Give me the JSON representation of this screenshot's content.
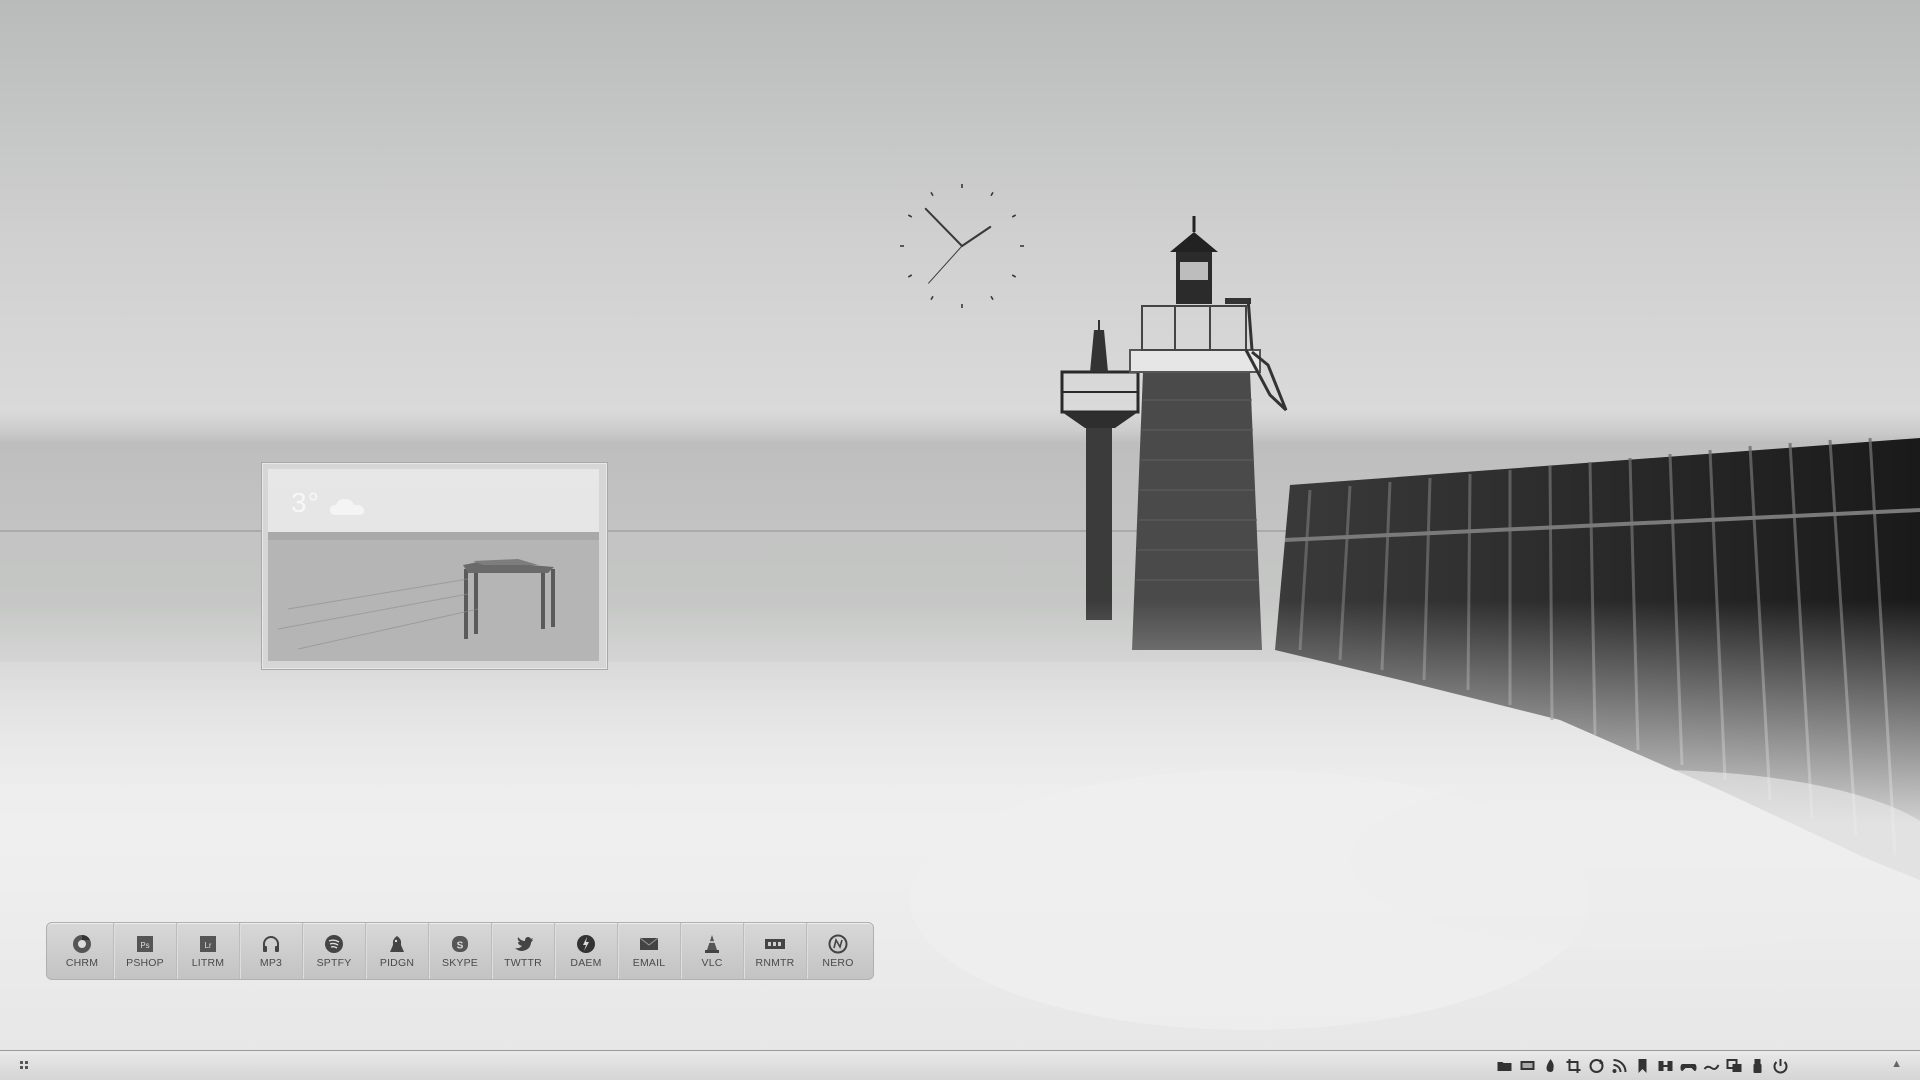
{
  "weather": {
    "temperature": "3°",
    "icon": "cloud-icon"
  },
  "clock": {
    "hour": 1,
    "minute": 52,
    "second": 37
  },
  "dock": {
    "items": [
      {
        "label": "CHRM",
        "icon": "chrome-icon"
      },
      {
        "label": "PSHOP",
        "icon": "photoshop-icon"
      },
      {
        "label": "LITRM",
        "icon": "lightroom-icon"
      },
      {
        "label": "MP3",
        "icon": "headphones-icon"
      },
      {
        "label": "SPTFY",
        "icon": "spotify-icon"
      },
      {
        "label": "PIDGN",
        "icon": "pidgin-icon"
      },
      {
        "label": "SKYPE",
        "icon": "skype-icon"
      },
      {
        "label": "TWTTR",
        "icon": "twitter-icon"
      },
      {
        "label": "DAEM",
        "icon": "daemon-tools-icon"
      },
      {
        "label": "EMAIL",
        "icon": "envelope-icon"
      },
      {
        "label": "VLC",
        "icon": "vlc-cone-icon"
      },
      {
        "label": "RNMTR",
        "icon": "rainmeter-icon"
      },
      {
        "label": "NERO",
        "icon": "nero-icon"
      }
    ]
  },
  "taskbar": {
    "tray_icons": [
      "folder-icon",
      "screen-icon",
      "fire-icon",
      "crop-icon",
      "sync-icon",
      "rss-icon",
      "bookmark-icon",
      "network-icon",
      "gamepad-icon",
      "link-icon",
      "window-icon",
      "usb-icon",
      "power-icon"
    ],
    "expand_icon": "caret-up-icon"
  }
}
